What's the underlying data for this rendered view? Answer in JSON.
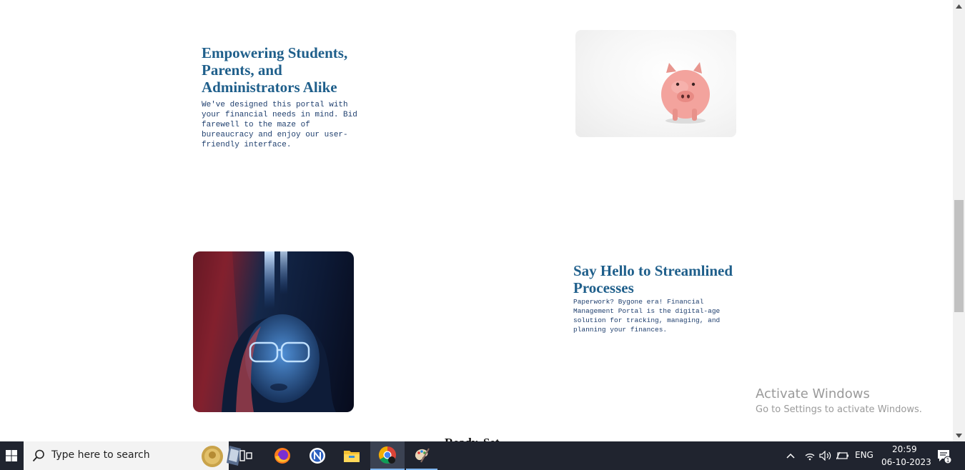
{
  "features": [
    {
      "title": "Empowering Students, Parents, and Administrators Alike",
      "description": "We've designed this portal with your financial needs in mind. Bid farewell to the maze of bureaucracy and enjoy our user-friendly interface."
    },
    {
      "title": "Say Hello to Streamlined Processes",
      "description": "Paperwork? Bygone era! Financial Management Portal is the digital-age solution for tracking, managing, and planning your finances."
    }
  ],
  "next_section": {
    "heading_partial": "Ready, Set..."
  },
  "watermark": {
    "title": "Activate Windows",
    "subtitle": "Go to Settings to activate Windows."
  },
  "taskbar": {
    "search_placeholder": "Type here to search",
    "apps": [
      "task-view",
      "firefox",
      "app-n",
      "file-explorer",
      "chrome",
      "paint"
    ],
    "active_app": "chrome",
    "language": "ENG",
    "time": "20:59",
    "date": "06-10-2023",
    "notification_count": "1"
  },
  "colors": {
    "heading": "#1f5f8b",
    "body_text": "#1f3f6e",
    "taskbar": "#20242f"
  }
}
